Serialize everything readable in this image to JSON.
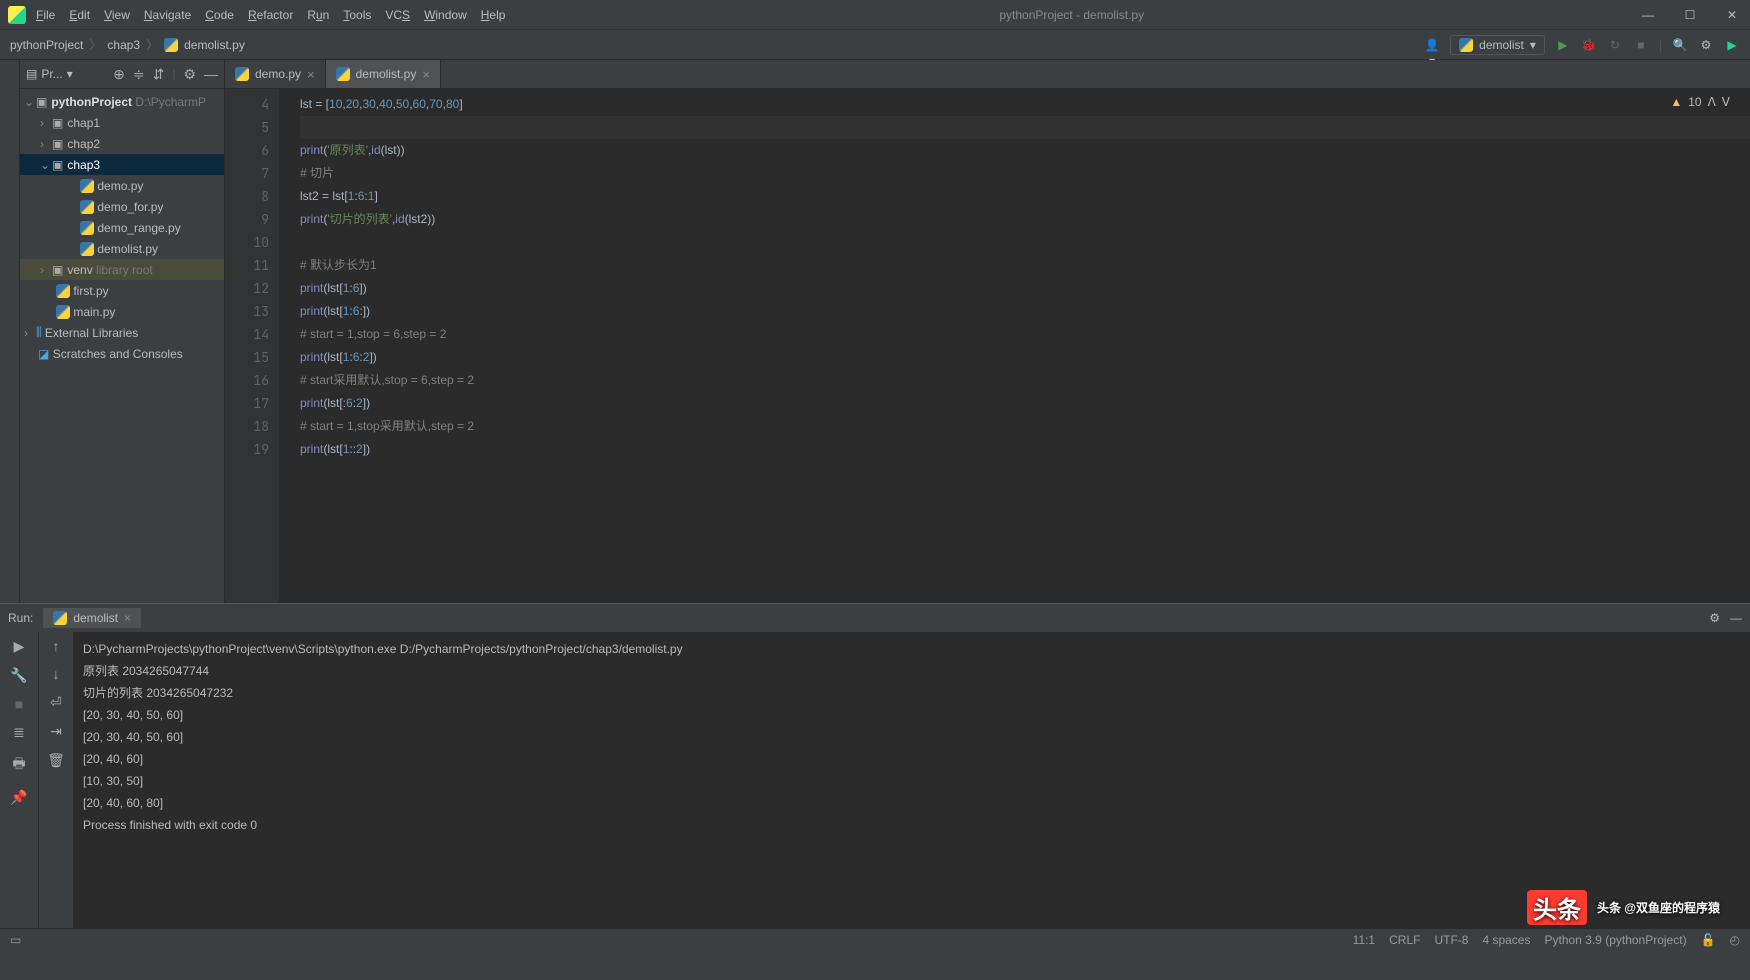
{
  "window": {
    "title": "pythonProject - demolist.py",
    "menu": [
      "File",
      "Edit",
      "View",
      "Navigate",
      "Code",
      "Refactor",
      "Run",
      "Tools",
      "VCS",
      "Window",
      "Help"
    ]
  },
  "breadcrumb": {
    "root": "pythonProject",
    "mid": "chap3",
    "file": "demolist.py"
  },
  "run_config": {
    "name": "demolist"
  },
  "project_tool": {
    "label": "Pr..."
  },
  "tree": {
    "root": {
      "name": "pythonProject",
      "path": "D:\\PycharmP"
    },
    "chap1": "chap1",
    "chap2": "chap2",
    "chap3": "chap3",
    "files": {
      "demo": "demo.py",
      "demo_for": "demo_for.py",
      "demo_range": "demo_range.py",
      "demolist": "demolist.py"
    },
    "venv": {
      "name": "venv",
      "hint": "library root"
    },
    "first": "first.py",
    "main": "main.py",
    "ext": "External Libraries",
    "scratch": "Scratches and Consoles"
  },
  "tabs": {
    "demo": "demo.py",
    "demolist": "demolist.py"
  },
  "editor": {
    "warn_count": "10",
    "lines": {
      "4": [
        [
          "txt",
          "lst "
        ],
        [
          "op",
          "= ["
        ],
        [
          "num",
          "10"
        ],
        [
          "op",
          ","
        ],
        [
          "num",
          "20"
        ],
        [
          "op",
          ","
        ],
        [
          "num",
          "30"
        ],
        [
          "op",
          ","
        ],
        [
          "num",
          "40"
        ],
        [
          "op",
          ","
        ],
        [
          "num",
          "50"
        ],
        [
          "op",
          ","
        ],
        [
          "num",
          "60"
        ],
        [
          "op",
          ","
        ],
        [
          "num",
          "70"
        ],
        [
          "op",
          ","
        ],
        [
          "num",
          "80"
        ],
        [
          "op",
          "]"
        ]
      ],
      "5": [
        [
          "txt",
          ""
        ]
      ],
      "6": [
        [
          "fn",
          "print"
        ],
        [
          "op",
          "("
        ],
        [
          "str",
          "'原列表'"
        ],
        [
          "op",
          ","
        ],
        [
          "fn",
          "id"
        ],
        [
          "op",
          "(lst))"
        ]
      ],
      "7": [
        [
          "cmt",
          "# 切片"
        ]
      ],
      "8": [
        [
          "txt",
          "lst2 "
        ],
        [
          "op",
          "= "
        ],
        [
          "txt",
          "lst["
        ],
        [
          "num",
          "1"
        ],
        [
          "op",
          ":"
        ],
        [
          "num",
          "6"
        ],
        [
          "op",
          ":"
        ],
        [
          "num",
          "1"
        ],
        [
          "op",
          "]"
        ]
      ],
      "9": [
        [
          "fn",
          "print"
        ],
        [
          "op",
          "("
        ],
        [
          "str",
          "'切片的列表'"
        ],
        [
          "op",
          ","
        ],
        [
          "fn",
          "id"
        ],
        [
          "op",
          "(lst2))"
        ]
      ],
      "10": [
        [
          "txt",
          ""
        ]
      ],
      "11": [
        [
          "cmt",
          "# 默认步长为1"
        ]
      ],
      "12": [
        [
          "fn",
          "print"
        ],
        [
          "op",
          "(lst["
        ],
        [
          "num",
          "1"
        ],
        [
          "op",
          ":"
        ],
        [
          "num",
          "6"
        ],
        [
          "op",
          "])"
        ]
      ],
      "13": [
        [
          "fn",
          "print"
        ],
        [
          "op",
          "(lst["
        ],
        [
          "num",
          "1"
        ],
        [
          "op",
          ":"
        ],
        [
          "num",
          "6"
        ],
        [
          "op",
          ":])"
        ]
      ],
      "14": [
        [
          "cmt",
          "# start = 1,stop = 6,step = 2"
        ]
      ],
      "15": [
        [
          "fn",
          "print"
        ],
        [
          "op",
          "(lst["
        ],
        [
          "num",
          "1"
        ],
        [
          "op",
          ":"
        ],
        [
          "num",
          "6"
        ],
        [
          "op",
          ":"
        ],
        [
          "num",
          "2"
        ],
        [
          "op",
          "])"
        ]
      ],
      "16": [
        [
          "cmt",
          "# start采用默认,stop = 6,step = 2"
        ]
      ],
      "17": [
        [
          "fn",
          "print"
        ],
        [
          "op",
          "(lst[:"
        ],
        [
          "num",
          "6"
        ],
        [
          "op",
          ":"
        ],
        [
          "num",
          "2"
        ],
        [
          "op",
          "])"
        ]
      ],
      "18": [
        [
          "cmt",
          "# start = 1,stop采用默认,step = 2"
        ]
      ],
      "19": [
        [
          "fn",
          "print"
        ],
        [
          "op",
          "(lst["
        ],
        [
          "num",
          "1"
        ],
        [
          "op",
          "::"
        ],
        [
          "num",
          "2"
        ],
        [
          "op",
          "])"
        ]
      ]
    },
    "line_numbers": [
      "4",
      "5",
      "6",
      "7",
      "8",
      "9",
      "10",
      "11",
      "12",
      "13",
      "14",
      "15",
      "16",
      "17",
      "18",
      "19"
    ]
  },
  "run": {
    "label": "Run:",
    "tab": "demolist",
    "output": [
      "D:\\PycharmProjects\\pythonProject\\venv\\Scripts\\python.exe D:/PycharmProjects/pythonProject/chap3/demolist.py",
      "原列表 2034265047744",
      "切片的列表 2034265047232",
      "[20, 30, 40, 50, 60]",
      "[20, 30, 40, 50, 60]",
      "[20, 40, 60]",
      "[10, 30, 50]",
      "[20, 40, 60, 80]",
      "",
      "Process finished with exit code 0"
    ]
  },
  "status": {
    "pos": "11:1",
    "eol": "CRLF",
    "enc": "UTF-8",
    "indent": "4 spaces",
    "sdk": "Python 3.9 (pythonProject)"
  },
  "watermark": "头条 @双鱼座的程序猿"
}
